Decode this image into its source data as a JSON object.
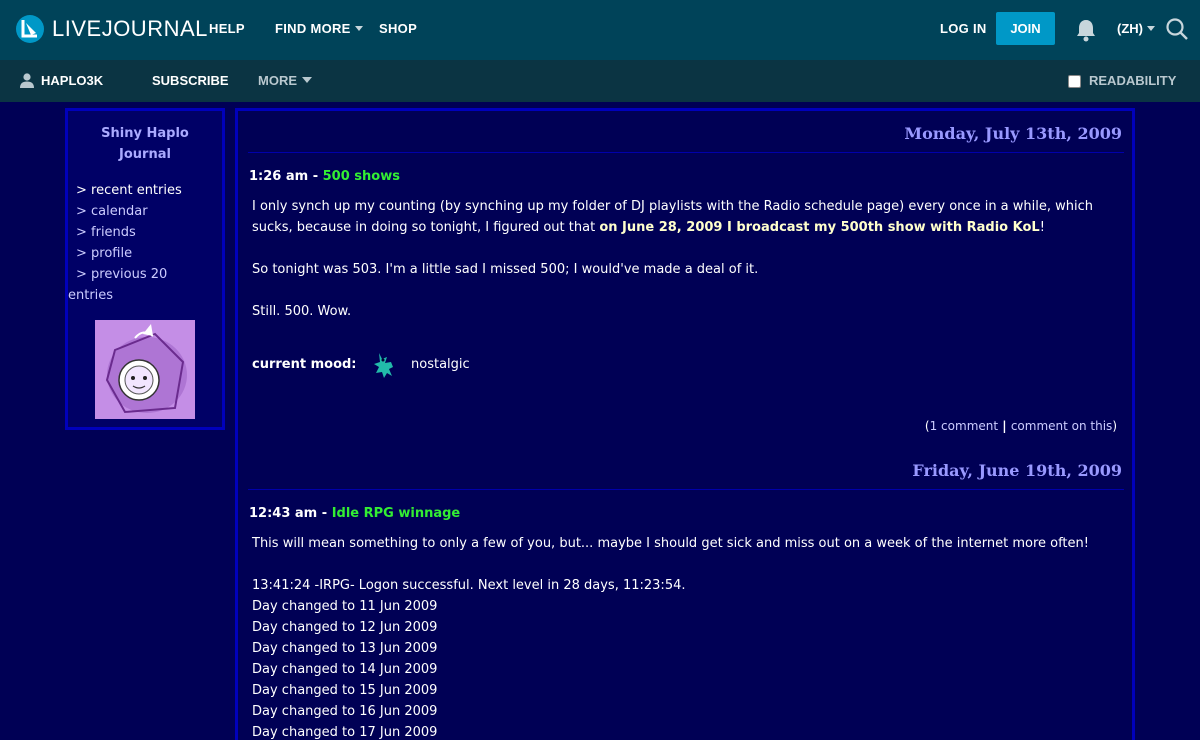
{
  "header": {
    "brand": "LIVEJOURNAL",
    "nav": [
      "HELP",
      "FIND MORE",
      "SHOP"
    ],
    "login": "LOG IN",
    "join": "JOIN",
    "language": "(ZH)"
  },
  "subnav": {
    "username": "HAPLO3K",
    "subscribe": "SUBSCRIBE",
    "more": "MORE",
    "readability": "READABILITY"
  },
  "sidebar": {
    "title_line1": "Shiny Haplo",
    "title_line2": "Journal",
    "links": [
      "> recent entries",
      "> calendar",
      "> friends",
      "> profile",
      "> previous 20",
      "entries"
    ]
  },
  "entries": [
    {
      "date": "Monday, July 13th, 2009",
      "time": "1:26 am",
      "separator": " - ",
      "subject": "500 shows",
      "p1_line1": "I only synch up my counting (by synching up my folder of DJ playlists with the Radio schedule page) every once in a while, which",
      "p1_line2_plain": "sucks, because in doing so tonight, I figured out that ",
      "p1_line2_bold": "on June 28, 2009 I broadcast my 500th show with Radio KoL",
      "p1_line2_end": "!",
      "p2": "So tonight was 503. I'm a little sad I missed 500; I would've made a deal of it.",
      "p3": "Still. 500. Wow.",
      "mood_label": "current mood:",
      "mood": "nostalgic",
      "comments_open": "(",
      "comment_count": "1 comment",
      "comment_sep": " | ",
      "comment_link": "comment on this",
      "comments_close": ")"
    },
    {
      "date": "Friday, June 19th, 2009",
      "time": "12:43 am",
      "separator": " - ",
      "subject": "Idle RPG winnage",
      "p1": "This will mean something to only a few of you, but... maybe I should get sick and miss out on a week of the internet more often!",
      "log": [
        "13:41:24 -IRPG- Logon successful. Next level in 28 days, 11:23:54.",
        "Day changed to 11 Jun 2009",
        "Day changed to 12 Jun 2009",
        "Day changed to 13 Jun 2009",
        "Day changed to 14 Jun 2009",
        "Day changed to 15 Jun 2009",
        "Day changed to 16 Jun 2009",
        "Day changed to 17 Jun 2009"
      ]
    }
  ],
  "icons": [
    "livejournal-logo-icon",
    "bell-icon",
    "search-icon",
    "user-icon",
    "mood-icon"
  ],
  "colors": {
    "topbar": "#004359",
    "subbar": "#0b3443",
    "page_bg": "#000055",
    "border": "#0000bb",
    "accent": "#0098c7",
    "subject": "#33ee33",
    "date": "#9999ff"
  }
}
